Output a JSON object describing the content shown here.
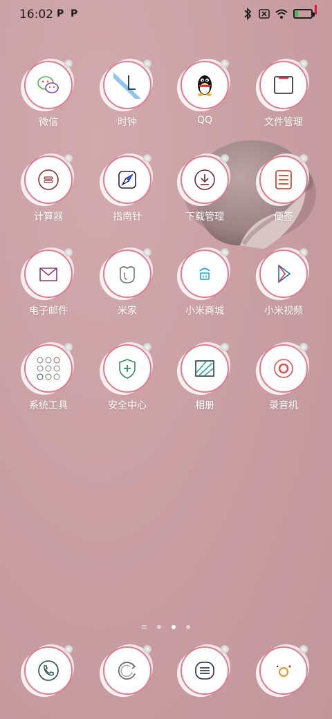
{
  "status_bar": {
    "time": "16:02",
    "notification_badges": [
      "P",
      "P"
    ],
    "icons": [
      "bluetooth-icon",
      "no-sim-icon",
      "wifi-icon",
      "battery-icon"
    ],
    "battery_level": 0.2,
    "battery_color": "#34c34a"
  },
  "apps": [
    {
      "label": "微信",
      "icon": "wechat-icon"
    },
    {
      "label": "时钟",
      "icon": "clock-icon"
    },
    {
      "label": "QQ",
      "icon": "qq-penguin-icon"
    },
    {
      "label": "文件管理",
      "icon": "folder-icon"
    },
    {
      "label": "计算器",
      "icon": "calculator-icon"
    },
    {
      "label": "指南针",
      "icon": "compass-icon"
    },
    {
      "label": "下载管理",
      "icon": "download-icon"
    },
    {
      "label": "便签",
      "icon": "notes-icon"
    },
    {
      "label": "电子邮件",
      "icon": "mail-icon"
    },
    {
      "label": "米家",
      "icon": "mijia-icon"
    },
    {
      "label": "小米商城",
      "icon": "mi-store-icon"
    },
    {
      "label": "小米视频",
      "icon": "mi-video-icon"
    },
    {
      "label": "系统工具",
      "icon": "folder-system-tools-icon"
    },
    {
      "label": "安全中心",
      "icon": "security-shield-icon"
    },
    {
      "label": "相册",
      "icon": "gallery-icon"
    },
    {
      "label": "录音机",
      "icon": "recorder-icon"
    }
  ],
  "page_indicator": {
    "pages": 3,
    "active": 2
  },
  "dock": [
    {
      "icon": "phone-icon"
    },
    {
      "icon": "browser-icon"
    },
    {
      "icon": "messages-icon"
    },
    {
      "icon": "camera-icon"
    }
  ],
  "colors": {
    "icon_ring": "#e07a8c",
    "label_text": "#ffffff"
  }
}
